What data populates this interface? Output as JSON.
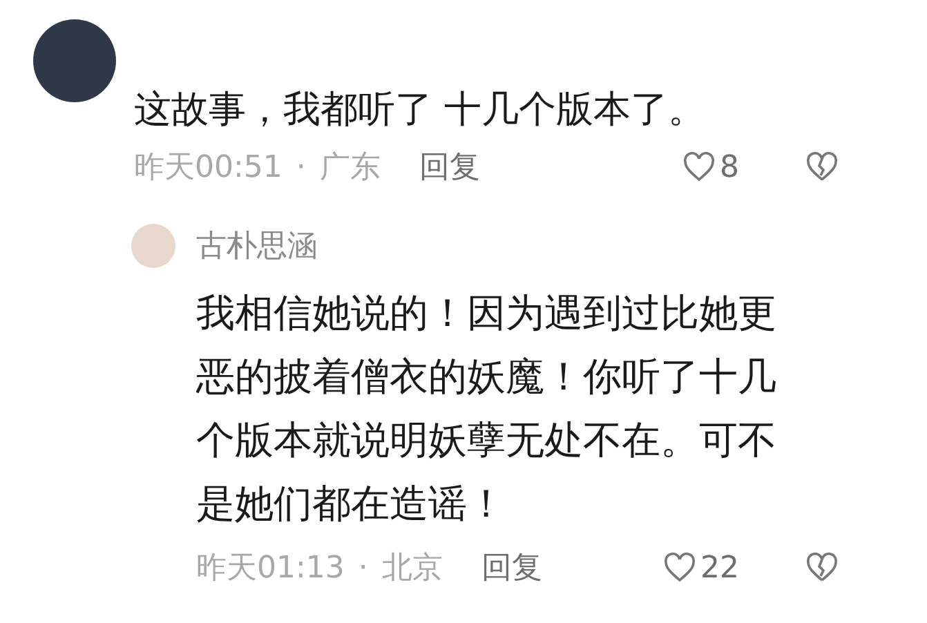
{
  "comment": {
    "text": "这故事，我都听了 十几个版本了。",
    "time": "昨天00:51",
    "separator": "·",
    "location": "广东",
    "reply_label": "回复",
    "likes": "8",
    "replies": [
      {
        "author": "古朴思涵",
        "text": "我相信她说的！因为遇到过比她更恶的披着僧衣的妖魔！你听了十几个版本就说明妖孽无处不在。可不是她们都在造谣！",
        "time": "昨天01:13",
        "separator": "·",
        "location": "北京",
        "reply_label": "回复",
        "likes": "22"
      }
    ]
  }
}
